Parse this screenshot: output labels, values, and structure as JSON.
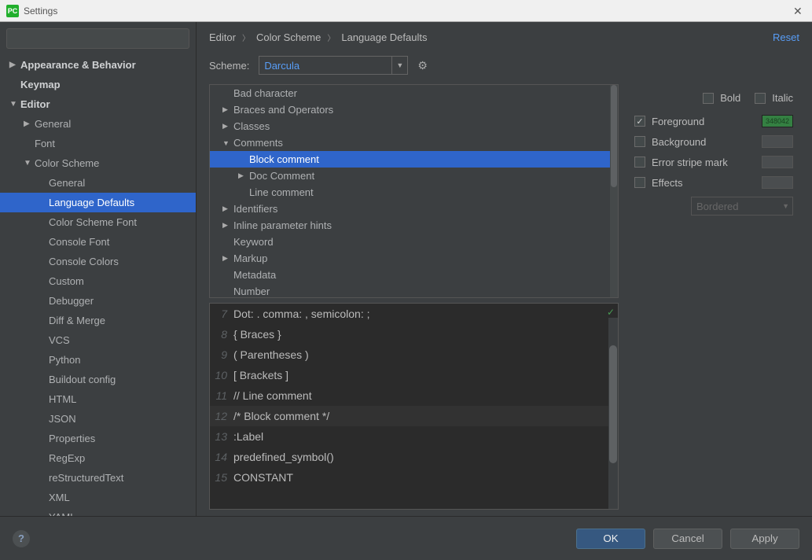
{
  "titlebar": {
    "app_icon": "PC",
    "title": "Settings"
  },
  "breadcrumb": {
    "a": "Editor",
    "b": "Color Scheme",
    "c": "Language Defaults",
    "reset": "Reset"
  },
  "scheme": {
    "label": "Scheme:",
    "value": "Darcula"
  },
  "tree": {
    "appearance": "Appearance & Behavior",
    "keymap": "Keymap",
    "editor": "Editor",
    "general": "General",
    "font": "Font",
    "colorscheme": "Color Scheme",
    "cs_general": "General",
    "cs_lang": "Language Defaults",
    "cs_font": "Color Scheme Font",
    "cs_confont": "Console Font",
    "cs_concolors": "Console Colors",
    "cs_custom": "Custom",
    "cs_debugger": "Debugger",
    "cs_diff": "Diff & Merge",
    "cs_vcs": "VCS",
    "cs_python": "Python",
    "cs_buildout": "Buildout config",
    "cs_html": "HTML",
    "cs_json": "JSON",
    "cs_props": "Properties",
    "cs_regexp": "RegExp",
    "cs_rst": "reStructuredText",
    "cs_xml": "XML",
    "cs_yaml": "YAML"
  },
  "attrs": {
    "badchar": "Bad character",
    "braces": "Braces and Operators",
    "classes": "Classes",
    "comments": "Comments",
    "blockcomment": "Block comment",
    "doccomment": "Doc Comment",
    "linecomment": "Line comment",
    "identifiers": "Identifiers",
    "inlinehints": "Inline parameter hints",
    "keyword": "Keyword",
    "markup": "Markup",
    "metadata": "Metadata",
    "number": "Number"
  },
  "props": {
    "bold": "Bold",
    "italic": "Italic",
    "foreground": "Foreground",
    "background": "Background",
    "errorstripe": "Error stripe mark",
    "effects": "Effects",
    "effect_type": "Bordered",
    "fg_color": "348042"
  },
  "preview": {
    "l7": {
      "n": "7",
      "t": "Dot: . comma: , semicolon: ;"
    },
    "l8": {
      "n": "8",
      "t": "{ Braces }"
    },
    "l9": {
      "n": "9",
      "t": "( Parentheses )"
    },
    "l10": {
      "n": "10",
      "t": "[ Brackets ]"
    },
    "l11": {
      "n": "11",
      "t": "// Line comment"
    },
    "l12": {
      "n": "12",
      "t": "/* Block comment */"
    },
    "l13": {
      "n": "13",
      "t": ":Label"
    },
    "l14": {
      "n": "14",
      "t": "predefined_symbol()"
    },
    "l15": {
      "n": "15",
      "t": "CONSTANT"
    }
  },
  "footer": {
    "ok": "OK",
    "cancel": "Cancel",
    "apply": "Apply"
  }
}
